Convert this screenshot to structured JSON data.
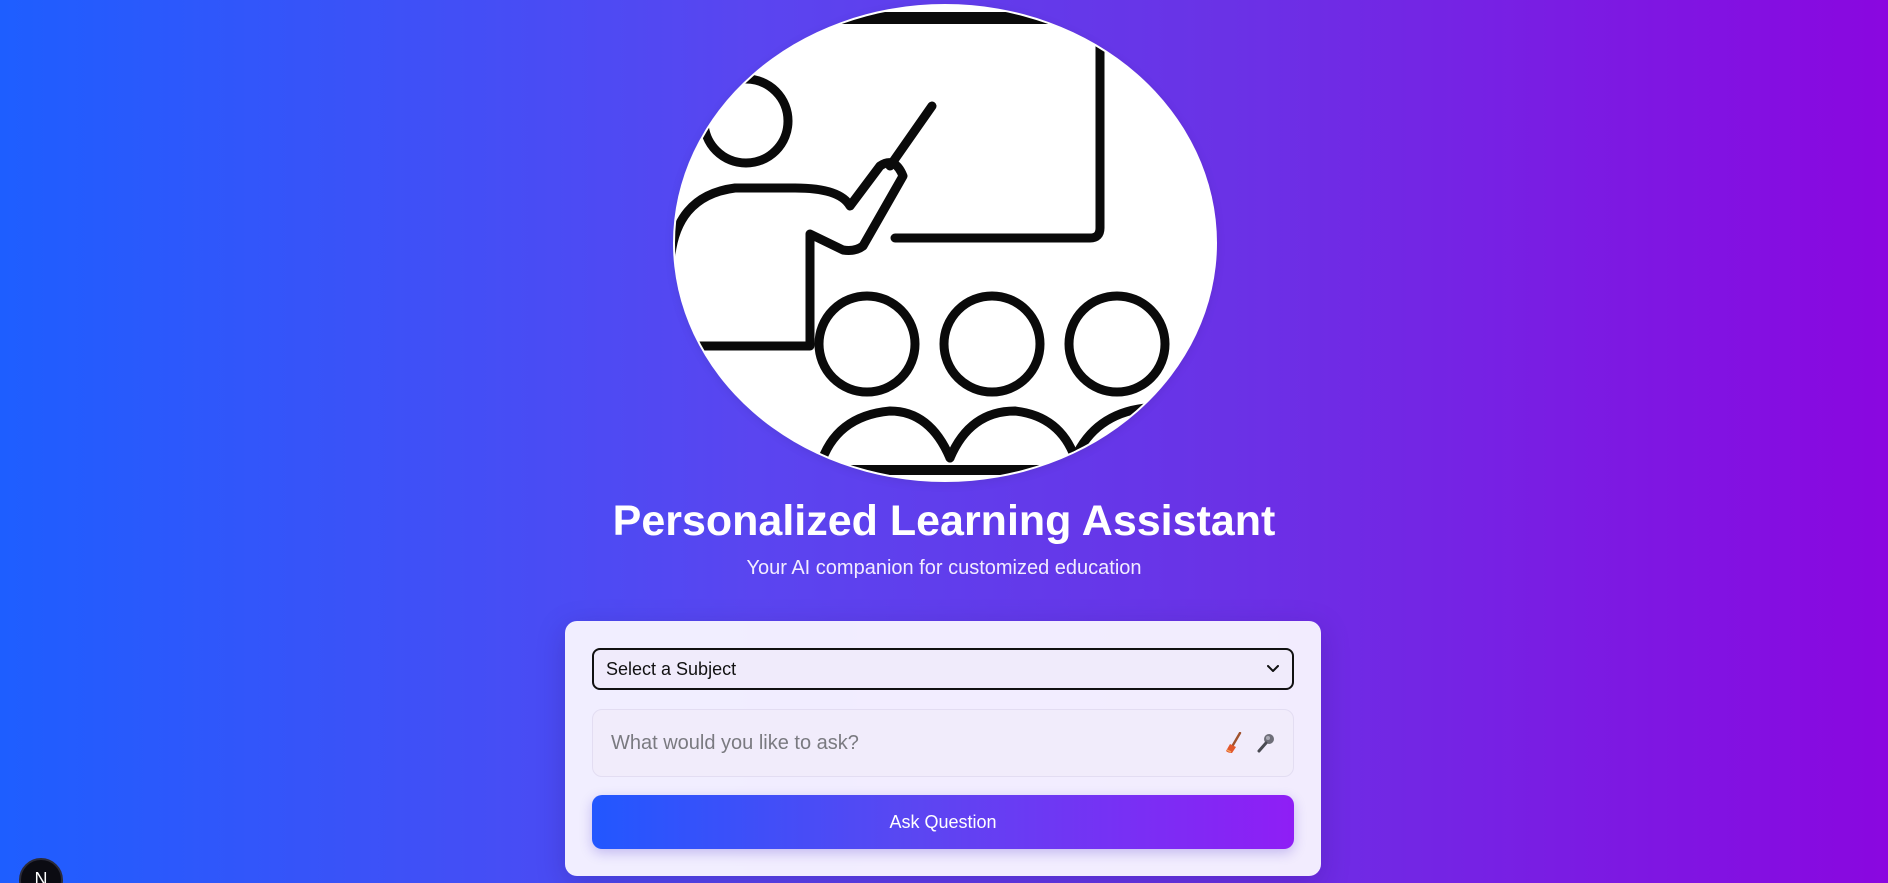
{
  "hero": {
    "image_name": "teacher-with-students-illustration"
  },
  "header": {
    "title": "Personalized Learning Assistant",
    "subtitle": "Your AI companion for customized education"
  },
  "form": {
    "subject_select": {
      "selected": "Select a Subject"
    },
    "question": {
      "placeholder": "What would you like to ask?",
      "value": ""
    },
    "icons": [
      "broom-icon",
      "microphone-icon"
    ],
    "ask_button_label": "Ask Question"
  },
  "dev_badge": {
    "label": "N"
  },
  "colors": {
    "gradient_start": "#1e5eff",
    "gradient_end": "#8a07e0",
    "card_background": "#f8f5ff",
    "button_gradient_start": "#2257ff",
    "button_gradient_end": "#8f1ef5"
  }
}
